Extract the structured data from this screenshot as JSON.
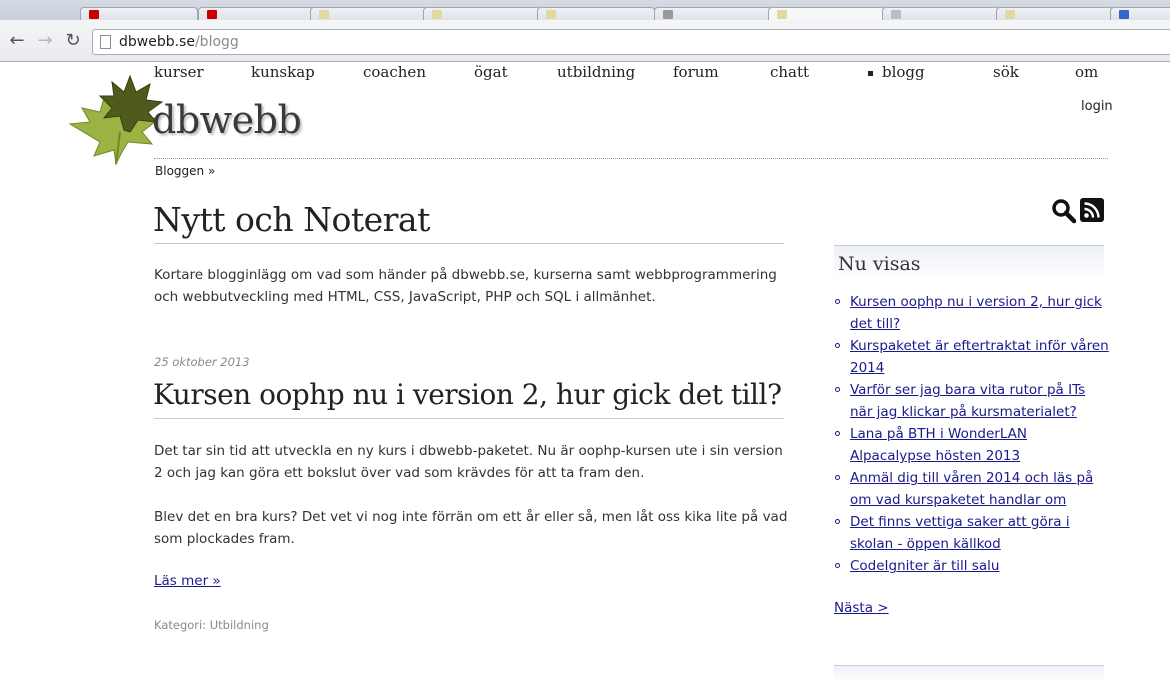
{
  "browser": {
    "url_domain": "dbwebb.se",
    "url_path": "/blogg",
    "tab_favicon_colors": [
      "#cc0000",
      "#cc0000",
      "#e2d9a0",
      "#e2d9a0",
      "#e2d9a0",
      "#9a9a9a",
      "#e2d9a0",
      "#b8bcc4",
      "#e2d9a0",
      "#3366cc"
    ]
  },
  "site": {
    "nav": [
      {
        "label": "kurser",
        "selected": false
      },
      {
        "label": "kunskap",
        "selected": false
      },
      {
        "label": "coachen",
        "selected": false
      },
      {
        "label": "ögat",
        "selected": false
      },
      {
        "label": "utbildning",
        "selected": false
      },
      {
        "label": "forum",
        "selected": false
      },
      {
        "label": "chatt",
        "selected": false
      },
      {
        "label": "blogg",
        "selected": true
      },
      {
        "label": "sök",
        "selected": false
      },
      {
        "label": "om",
        "selected": false
      }
    ],
    "title": "dbwebb",
    "login": "login",
    "breadcrumb": "Bloggen »"
  },
  "main": {
    "page_title": "Nytt och Noterat",
    "intro": "Kortare blogginlägg om vad som händer på dbwebb.se, kurserna samt webbprogrammering och webbutveckling med HTML, CSS, JavaScript, PHP och SQL i allmänhet.",
    "post": {
      "date": "25 oktober 2013",
      "title": "Kursen oophp nu i version 2, hur gick det till?",
      "paragraphs": [
        "Det tar sin tid att utveckla en ny kurs i dbwebb-paketet. Nu är oophp-kursen ute i sin version 2 och jag kan göra ett bokslut över vad som krävdes för att ta fram den.",
        "Blev det en bra kurs? Det vet vi nog inte förrän om ett år eller så, men låt oss kika lite på vad som plockades fram."
      ],
      "read_more": "Läs mer »",
      "category": "Kategori: Utbildning"
    }
  },
  "sidebar": {
    "heading": "Nu visas",
    "items": [
      "Kursen oophp nu i version 2, hur gick det till?",
      "Kurspaketet är eftertraktat inför våren 2014",
      "Varför ser jag bara vita rutor på ITs när jag klickar på kursmaterialet?",
      "Lana på BTH i WonderLAN Alpacalypse hösten 2013",
      "Anmäl dig till våren 2014 och läs på om vad kurspaketet handlar om",
      "Det finns vettiga saker att göra i skolan - öppen källkod",
      "CodeIgniter är till salu"
    ],
    "next": "Nästa >"
  },
  "colors": {
    "link": "#1a1a8c",
    "muted": "#8a8a8a",
    "text": "#333333"
  },
  "icons": [
    "back-arrow-icon",
    "forward-arrow-icon",
    "reload-icon",
    "page-icon",
    "search-icon",
    "rss-icon",
    "maple-leaf-logo-icon"
  ]
}
